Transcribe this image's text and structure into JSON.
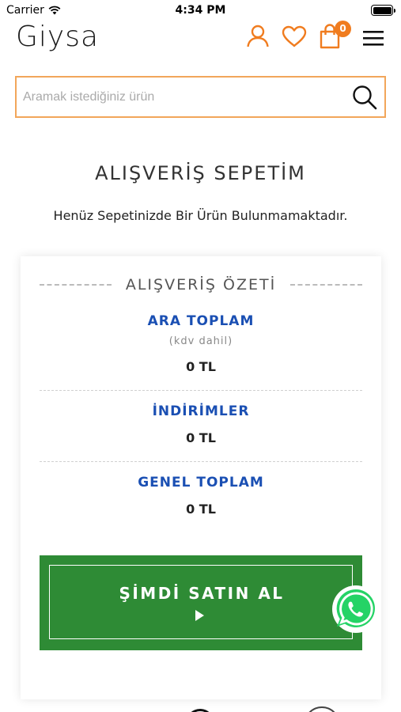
{
  "status_bar": {
    "carrier": "Carrier",
    "time": "4:34 PM"
  },
  "header": {
    "logo": "Giysa",
    "cart_count": "0",
    "accent_color": "#f07c1f",
    "icons": [
      "user-icon",
      "heart-icon",
      "shopping-bag-icon",
      "hamburger-menu-icon"
    ]
  },
  "search": {
    "placeholder": "Aramak istediğiniz ürün",
    "value": ""
  },
  "cart": {
    "title": "ALIŞVERİŞ SEPETİM",
    "empty_message": "Henüz Sepetinizde Bir Ürün Bulunmamaktadır."
  },
  "summary": {
    "title": "ALIŞVERİŞ ÖZETİ",
    "subtotal_label": "ARA TOPLAM",
    "subtotal_note": "(kdv dahil)",
    "subtotal_value": "0 TL",
    "discounts_label": "İNDİRİMLER",
    "discounts_value": "0 TL",
    "total_label": "GENEL TOPLAM",
    "total_value": "0 TL",
    "label_color": "#1a4fb3"
  },
  "buy_button": {
    "label": "ŞİMDİ SATIN AL",
    "color": "#2e8b35"
  },
  "whatsapp": {
    "color": "#25d366"
  }
}
